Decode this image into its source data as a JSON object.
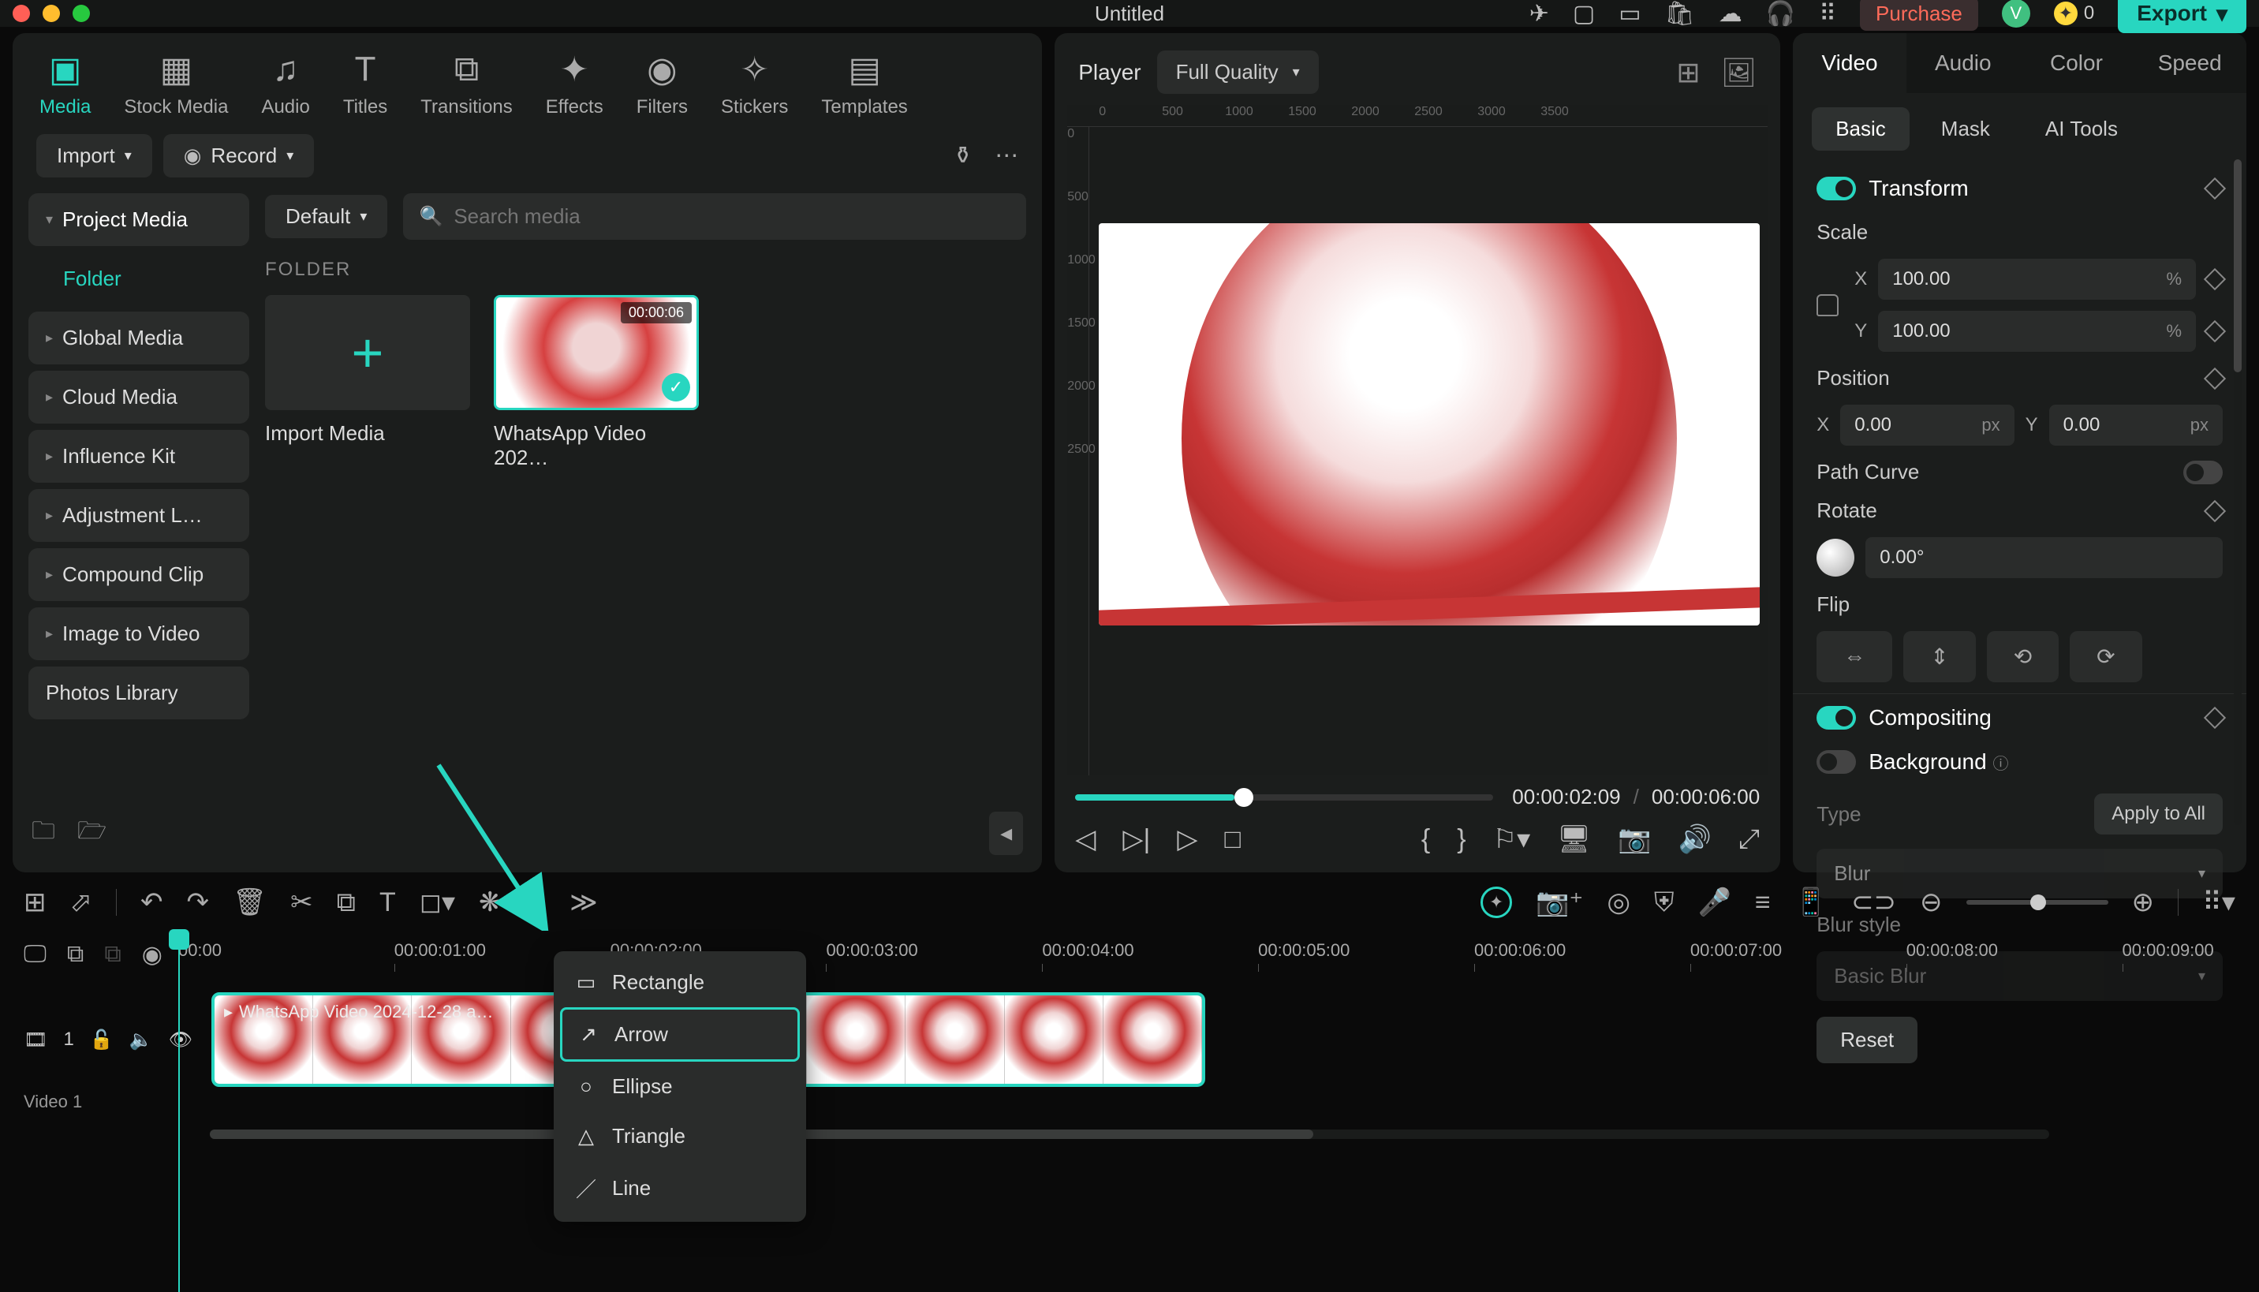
{
  "title": "Untitled",
  "titlebar": {
    "purchase": "Purchase",
    "avatar_letter": "V",
    "coins": "0",
    "export": "Export"
  },
  "top_tabs": [
    "Media",
    "Stock Media",
    "Audio",
    "Titles",
    "Transitions",
    "Effects",
    "Filters",
    "Stickers",
    "Templates"
  ],
  "media": {
    "import": "Import",
    "record": "Record",
    "sidebar": {
      "project": "Project Media",
      "folder": "Folder",
      "items": [
        "Global Media",
        "Cloud Media",
        "Influence Kit",
        "Adjustment L…",
        "Compound Clip",
        "Image to Video",
        "Photos Library"
      ]
    },
    "sort": "Default",
    "search_placeholder": "Search media",
    "folder_label": "FOLDER",
    "import_card": "Import Media",
    "video_card": "WhatsApp Video 202…",
    "video_dur": "00:00:06"
  },
  "player": {
    "label": "Player",
    "quality": "Full Quality",
    "ruler_h": [
      "0",
      "500",
      "1000",
      "1500",
      "2000",
      "2500",
      "3000",
      "3500"
    ],
    "ruler_v": [
      "0",
      "500",
      "1000",
      "1500",
      "2000",
      "2500"
    ],
    "cur": "00:00:02:09",
    "sep": "/",
    "dur": "00:00:06:00"
  },
  "right": {
    "tabs": [
      "Video",
      "Audio",
      "Color",
      "Speed"
    ],
    "subtabs": [
      "Basic",
      "Mask",
      "AI Tools"
    ],
    "transform": "Transform",
    "scale": "Scale",
    "scale_x": "100.00",
    "scale_y": "100.00",
    "pct": "%",
    "position": "Position",
    "pos_x": "0.00",
    "pos_y": "0.00",
    "px": "px",
    "path_curve": "Path Curve",
    "rotate": "Rotate",
    "rotate_val": "0.00°",
    "flip": "Flip",
    "compositing": "Compositing",
    "background": "Background",
    "type": "Type",
    "apply_all": "Apply to All",
    "blur": "Blur",
    "blur_style": "Blur style",
    "basic_blur": "Basic Blur",
    "reset": "Reset"
  },
  "timeline": {
    "marks": [
      "00:00",
      "00:00:01:00",
      "00:00:02:00",
      "00:00:03:00",
      "00:00:04:00",
      "00:00:05:00",
      "00:00:06:00",
      "00:00:07:00",
      "00:00:08:00",
      "00:00:09:00"
    ],
    "track_num": "1",
    "track_label": "Video 1",
    "clip_name": "WhatsApp Video 2024-12-28 a…"
  },
  "shape_menu": [
    "Rectangle",
    "Arrow",
    "Ellipse",
    "Triangle",
    "Line"
  ]
}
